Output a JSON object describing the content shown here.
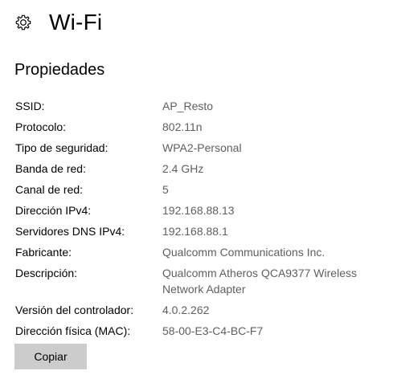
{
  "header": {
    "icon": "gear-icon",
    "title": "Wi-Fi"
  },
  "section": {
    "title": "Propiedades"
  },
  "properties": [
    {
      "label": "SSID:",
      "value": "AP_Resto"
    },
    {
      "label": "Protocolo:",
      "value": "802.11n"
    },
    {
      "label": "Tipo de seguridad:",
      "value": "WPA2-Personal"
    },
    {
      "label": "Banda de red:",
      "value": "2.4 GHz"
    },
    {
      "label": "Canal de red:",
      "value": "5"
    },
    {
      "label": "Dirección IPv4:",
      "value": "192.168.88.13"
    },
    {
      "label": "Servidores DNS IPv4:",
      "value": "192.168.88.1"
    },
    {
      "label": "Fabricante:",
      "value": "Qualcomm Communications Inc."
    },
    {
      "label": "Descripción:",
      "value": "Qualcomm Atheros QCA9377 Wireless Network Adapter"
    },
    {
      "label": "Versión del controlador:",
      "value": "4.0.2.262"
    },
    {
      "label": "Dirección física (MAC):",
      "value": "58-00-E3-C4-BC-F7"
    }
  ],
  "actions": {
    "copy_label": "Copiar"
  },
  "colors": {
    "value_text": "#5f5f5f",
    "button_bg": "#cccccc"
  }
}
